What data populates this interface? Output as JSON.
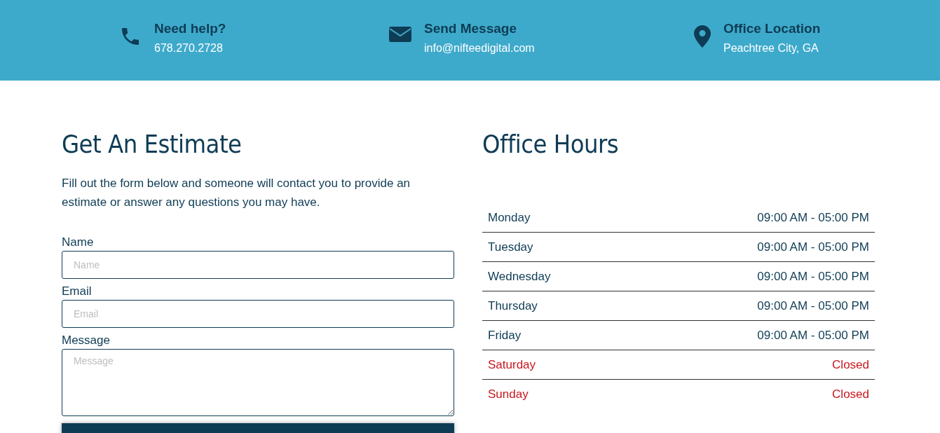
{
  "contact_bar": [
    {
      "kind": "phone",
      "title": "Need help?",
      "detail": "678.270.2728"
    },
    {
      "kind": "mail",
      "title": "Send Message",
      "detail": "info@nifteedigital.com"
    },
    {
      "kind": "location",
      "title": "Office Location",
      "detail": "Peachtree City, GA"
    }
  ],
  "estimate": {
    "title": "Get An Estimate",
    "intro": "Fill out the form below and someone will contact you to provide an estimate or answer any questions you may have.",
    "fields": [
      {
        "kind": "input",
        "label": "Name",
        "placeholder": "Name"
      },
      {
        "kind": "input",
        "label": "Email",
        "placeholder": "Email"
      },
      {
        "kind": "textarea",
        "label": "Message",
        "placeholder": "Message"
      }
    ]
  },
  "office_hours": {
    "title": "Office Hours",
    "rows": [
      {
        "day": "Monday",
        "hours": "09:00 AM - 05:00 PM",
        "closed": false
      },
      {
        "day": "Tuesday",
        "hours": "09:00 AM - 05:00 PM",
        "closed": false
      },
      {
        "day": "Wednesday",
        "hours": "09:00 AM - 05:00 PM",
        "closed": false
      },
      {
        "day": "Thursday",
        "hours": "09:00 AM - 05:00 PM",
        "closed": false
      },
      {
        "day": "Friday",
        "hours": "09:00 AM - 05:00 PM",
        "closed": false
      },
      {
        "day": "Saturday",
        "hours": "Closed",
        "closed": true
      },
      {
        "day": "Sunday",
        "hours": "Closed",
        "closed": true
      }
    ]
  }
}
